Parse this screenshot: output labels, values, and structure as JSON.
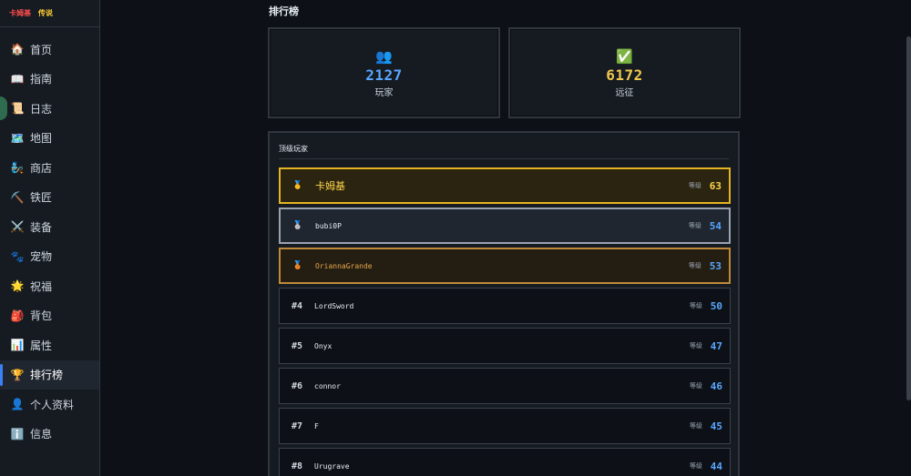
{
  "brand": {
    "name": "卡姆基",
    "tag": "传说"
  },
  "nav": [
    {
      "icon": "🏠",
      "label": "首页"
    },
    {
      "icon": "📖",
      "label": "指南"
    },
    {
      "icon": "📜",
      "label": "日志"
    },
    {
      "icon": "🗺️",
      "label": "地图"
    },
    {
      "icon": "🧞",
      "label": "商店"
    },
    {
      "icon": "⛏️",
      "label": "铁匠"
    },
    {
      "icon": "⚔️",
      "label": "装备"
    },
    {
      "icon": "🐾",
      "label": "宠物"
    },
    {
      "icon": "🌟",
      "label": "祝福"
    },
    {
      "icon": "🎒",
      "label": "背包"
    },
    {
      "icon": "📊",
      "label": "属性"
    },
    {
      "icon": "🏆",
      "label": "排行榜"
    },
    {
      "icon": "👤",
      "label": "个人资料"
    },
    {
      "icon": "ℹ️",
      "label": "信息"
    }
  ],
  "active_nav": "排行榜",
  "page": {
    "title": "排行榜"
  },
  "stats": {
    "players": {
      "icon": "👥",
      "value": "2127",
      "label": "玩家"
    },
    "expeditions": {
      "icon": "✅",
      "value": "6172",
      "label": "远征"
    }
  },
  "leaderboard": {
    "title": "顶级玩家",
    "level_label": "等级",
    "rows": [
      {
        "rank": "",
        "medal": "🥇",
        "name": "卡姆基",
        "level": "63",
        "style": "gold"
      },
      {
        "rank": "",
        "medal": "🥈",
        "name": "bubi0P",
        "level": "54",
        "style": "silver"
      },
      {
        "rank": "",
        "medal": "🥉",
        "name": "OriannaGrande",
        "level": "53",
        "style": "bronze"
      },
      {
        "rank": "#4",
        "medal": "",
        "name": "LordSword",
        "level": "50",
        "style": ""
      },
      {
        "rank": "#5",
        "medal": "",
        "name": "Onyx",
        "level": "47",
        "style": ""
      },
      {
        "rank": "#6",
        "medal": "",
        "name": "connor",
        "level": "46",
        "style": ""
      },
      {
        "rank": "#7",
        "medal": "",
        "name": "F",
        "level": "45",
        "style": ""
      },
      {
        "rank": "#8",
        "medal": "",
        "name": "Urugrave",
        "level": "44",
        "style": ""
      }
    ]
  },
  "colors": {
    "accent": "#3b82f6",
    "gold": "#e6b422",
    "silver": "#9aa4b0",
    "bronze": "#c08a3a",
    "stat_blue": "#58a6ff",
    "stat_gold": "#f2c94c"
  }
}
